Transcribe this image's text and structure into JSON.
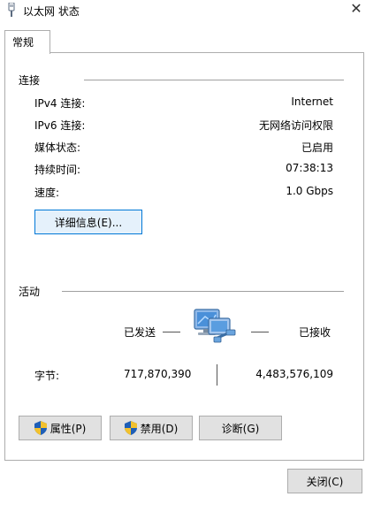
{
  "window": {
    "title": "以太网 状态",
    "close_glyph": "✕"
  },
  "tabs": [
    {
      "label": "常规"
    }
  ],
  "connection": {
    "section_label": "连接",
    "rows": [
      {
        "label": "IPv4 连接:",
        "value": "Internet"
      },
      {
        "label": "IPv6 连接:",
        "value": "无网络访问权限"
      },
      {
        "label": "媒体状态:",
        "value": "已启用"
      },
      {
        "label": "持续时间:",
        "value": "07:38:13"
      },
      {
        "label": "速度:",
        "value": "1.0 Gbps"
      }
    ],
    "details_button": "详细信息(E)..."
  },
  "activity": {
    "section_label": "活动",
    "sent_label": "已发送",
    "received_label": "已接收",
    "bytes_label": "字节:",
    "bytes_sent": "717,870,390",
    "bytes_received": "4,483,576,109"
  },
  "buttons": {
    "properties": "属性(P)",
    "disable": "禁用(D)",
    "diagnose": "诊断(G)",
    "close": "关闭(C)"
  },
  "icons": {
    "app": "network-adapter-icon",
    "network": "network-computer-icon",
    "shield": "uac-shield-icon"
  }
}
